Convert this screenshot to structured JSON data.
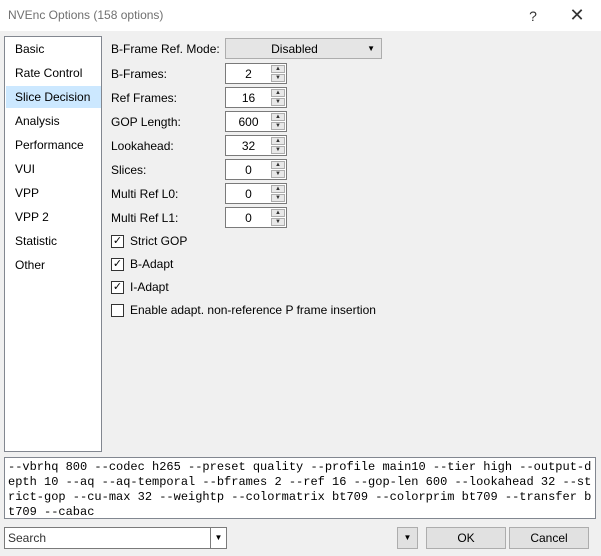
{
  "window": {
    "title": "NVEnc Options (158 options)",
    "help_glyph": "?",
    "close_glyph": "✕"
  },
  "sidebar": {
    "items": [
      {
        "label": "Basic"
      },
      {
        "label": "Rate Control"
      },
      {
        "label": "Slice Decision",
        "selected": true
      },
      {
        "label": "Analysis"
      },
      {
        "label": "Performance"
      },
      {
        "label": "VUI"
      },
      {
        "label": "VPP"
      },
      {
        "label": "VPP 2"
      },
      {
        "label": "Statistic"
      },
      {
        "label": "Other"
      }
    ]
  },
  "fields": {
    "bframe_ref_mode": {
      "label": "B-Frame Ref. Mode:",
      "value": "Disabled"
    },
    "bframes": {
      "label": "B-Frames:",
      "value": "2"
    },
    "ref_frames": {
      "label": "Ref Frames:",
      "value": "16"
    },
    "gop_length": {
      "label": "GOP Length:",
      "value": "600"
    },
    "lookahead": {
      "label": "Lookahead:",
      "value": "32"
    },
    "slices": {
      "label": "Slices:",
      "value": "0"
    },
    "multi_ref_l0": {
      "label": "Multi Ref L0:",
      "value": "0"
    },
    "multi_ref_l1": {
      "label": "Multi Ref L1:",
      "value": "0"
    }
  },
  "checkboxes": {
    "strict_gop": {
      "label": "Strict GOP",
      "checked": true
    },
    "b_adapt": {
      "label": "B-Adapt",
      "checked": true
    },
    "i_adapt": {
      "label": "I-Adapt",
      "checked": true
    },
    "nonref_p": {
      "label": "Enable adapt. non-reference P frame insertion",
      "checked": false
    }
  },
  "command_line": "--vbrhq 800 --codec h265 --preset quality --profile main10 --tier high --output-depth 10 --aq --aq-temporal --bframes 2 --ref 16 --gop-len 600 --lookahead 32 --strict-gop --cu-max 32 --weightp --colormatrix bt709 --colorprim bt709 --transfer bt709 --cabac",
  "footer": {
    "search_placeholder": "Search",
    "ok_label": "OK",
    "cancel_label": "Cancel"
  },
  "colors": {
    "selected_item_bg": "#cce8ff",
    "window_bg": "#f0f0f0"
  }
}
